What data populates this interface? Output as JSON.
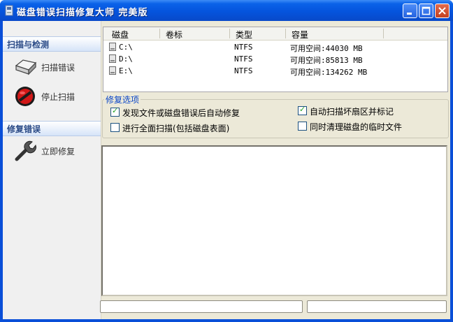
{
  "window": {
    "title": "磁盘错误扫描修复大师 完美版"
  },
  "sidebar": {
    "sections": [
      {
        "header": "扫描与检测",
        "items": [
          {
            "label": "扫描错误",
            "icon": "disk-drive-icon"
          },
          {
            "label": "停止扫描",
            "icon": "stop-icon"
          }
        ]
      },
      {
        "header": "修复错误",
        "items": [
          {
            "label": "立即修复",
            "icon": "wrench-icon"
          }
        ]
      }
    ]
  },
  "drives": {
    "columns": [
      "磁盘",
      "卷标",
      "类型",
      "容量"
    ],
    "rows": [
      {
        "drive": "C:\\",
        "label": "",
        "type": "NTFS",
        "capacity": "可用空间:44030 MB"
      },
      {
        "drive": "D:\\",
        "label": "",
        "type": "NTFS",
        "capacity": "可用空间:85813 MB"
      },
      {
        "drive": "E:\\",
        "label": "",
        "type": "NTFS",
        "capacity": "可用空间:134262 MB"
      }
    ]
  },
  "options": {
    "title": "修复选项",
    "items": [
      {
        "label": "发现文件或磁盘错误后自动修复",
        "checked": true
      },
      {
        "label": "自动扫描坏扇区并标记",
        "checked": true
      },
      {
        "label": "进行全面扫描(包括磁盘表面)",
        "checked": false
      },
      {
        "label": "同时清理磁盘的临时文件",
        "checked": false
      }
    ],
    "check_glyph": "✓"
  },
  "log": {
    "text": ""
  },
  "status": {
    "left": "",
    "right": ""
  },
  "colors": {
    "title_bar": "#0554dd",
    "sidebar_header": "#2a4a86",
    "group_title": "#0b46c8"
  }
}
